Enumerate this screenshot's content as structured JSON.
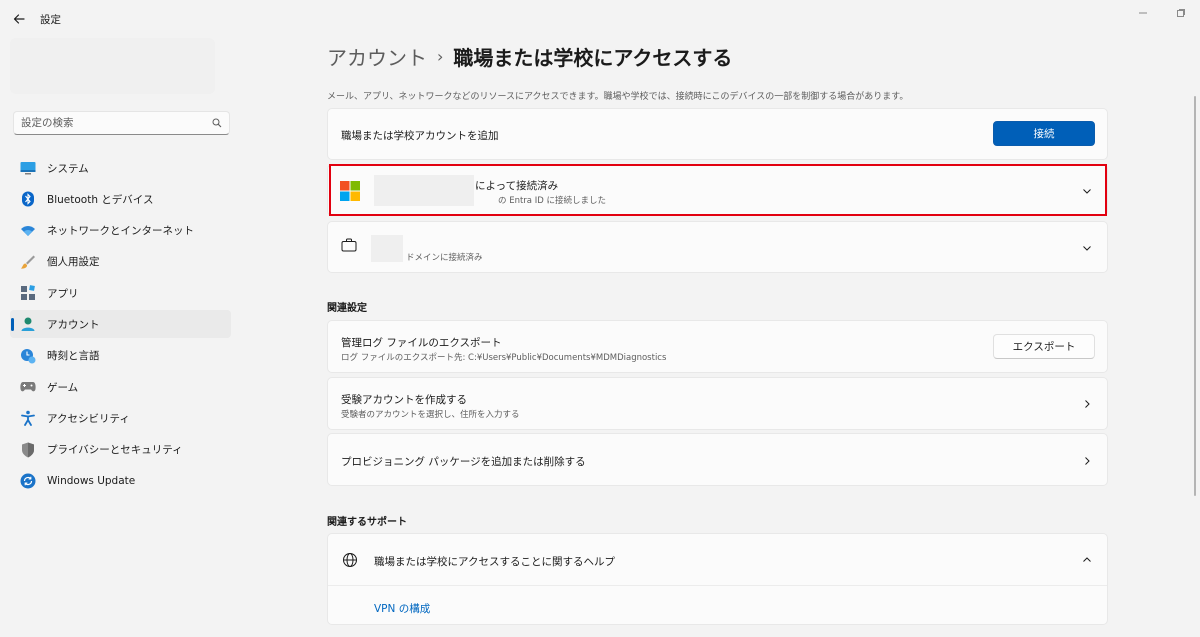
{
  "window": {
    "title": "設定",
    "back_icon": "back-arrow-icon",
    "controls": [
      "minimize",
      "restore"
    ]
  },
  "sidebar": {
    "search_placeholder": "設定の検索",
    "items": [
      {
        "label": "システム",
        "icon": "system-icon",
        "active": false
      },
      {
        "label": "Bluetooth とデバイス",
        "icon": "bluetooth-icon",
        "active": false
      },
      {
        "label": "ネットワークとインターネット",
        "icon": "wifi-icon",
        "active": false
      },
      {
        "label": "個人用設定",
        "icon": "brush-icon",
        "active": false
      },
      {
        "label": "アプリ",
        "icon": "apps-icon",
        "active": false
      },
      {
        "label": "アカウント",
        "icon": "account-icon",
        "active": true
      },
      {
        "label": "時刻と言語",
        "icon": "time-language-icon",
        "active": false
      },
      {
        "label": "ゲーム",
        "icon": "gamepad-icon",
        "active": false
      },
      {
        "label": "アクセシビリティ",
        "icon": "accessibility-icon",
        "active": false
      },
      {
        "label": "プライバシーとセキュリティ",
        "icon": "shield-icon",
        "active": false
      },
      {
        "label": "Windows Update",
        "icon": "windows-update-icon",
        "active": false
      }
    ]
  },
  "main": {
    "breadcrumb_parent": "アカウント",
    "breadcrumb_separator": "›",
    "breadcrumb_current": "職場または学校にアクセスする",
    "description": "メール、アプリ、ネットワークなどのリソースにアクセスできます。職場や学校では、接続時にこのデバイスの一部を制御する場合があります。",
    "add_account": {
      "label": "職場または学校アカウントを追加",
      "button": "接続"
    },
    "entra_account": {
      "title": "によって接続済み",
      "subtitle": "の Entra ID に接続しました"
    },
    "domain_account": {
      "subtitle": "ドメインに接続済み"
    },
    "related_settings": {
      "heading": "関連設定",
      "export_title": "管理ログ ファイルのエクスポート",
      "export_sub": "ログ ファイルのエクスポート先: C:¥Users¥Public¥Documents¥MDMDiagnostics",
      "export_button": "エクスポート",
      "exam_title": "受験アカウントを作成する",
      "exam_sub": "受験者のアカウントを選択し、住所を入力する",
      "provisioning_title": "プロビジョニング パッケージを追加または削除する"
    },
    "related_support": {
      "heading": "関連するサポート",
      "help_title": "職場または学校にアクセスすることに関するヘルプ",
      "vpn_link": "VPN の構成"
    }
  },
  "colors": {
    "accent": "#005fb8",
    "highlight": "#e2000f",
    "background": "#f3f3f3",
    "card": "#fbfbfb"
  }
}
